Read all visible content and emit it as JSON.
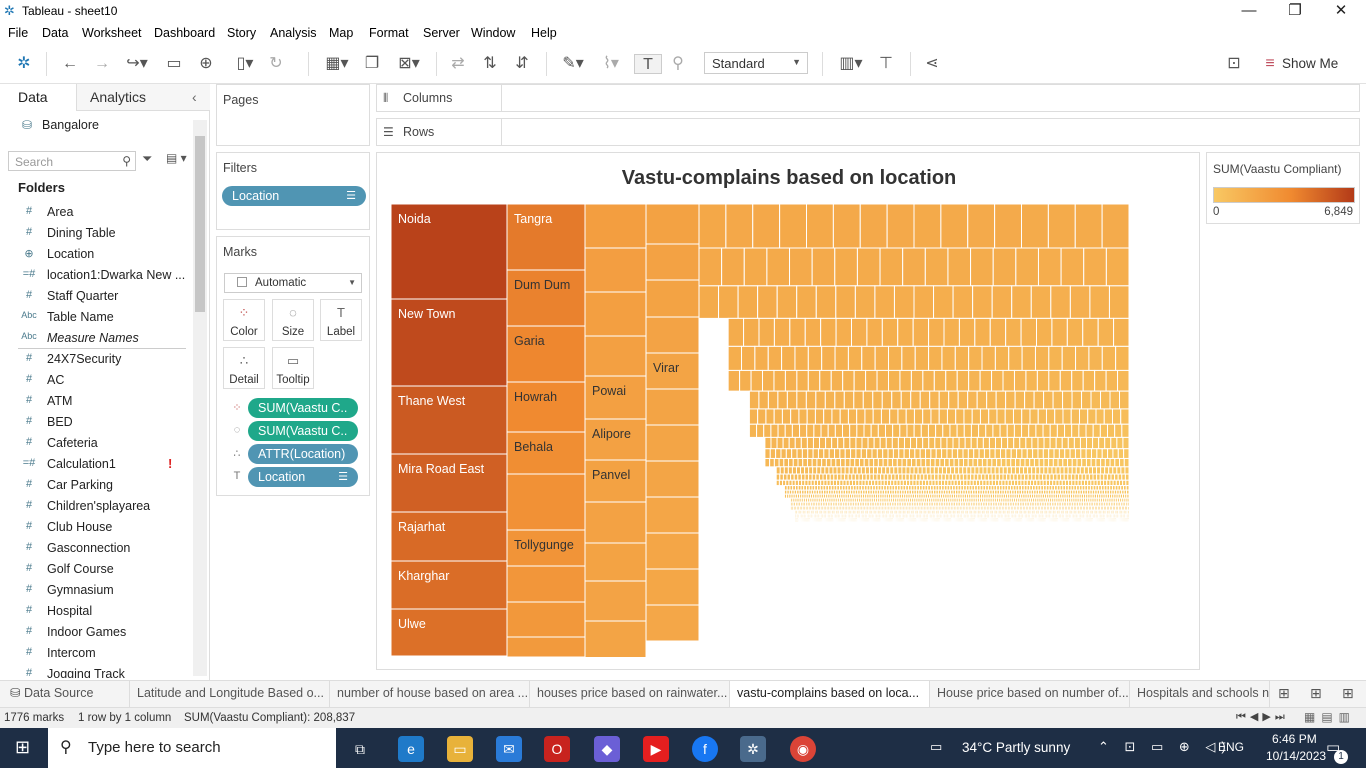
{
  "window": {
    "title": "Tableau - sheet10",
    "min": "—",
    "max": "❐",
    "close": "✕"
  },
  "menu": [
    "File",
    "Data",
    "Worksheet",
    "Dashboard",
    "Story",
    "Analysis",
    "Map",
    "Format",
    "Server",
    "Window",
    "Help"
  ],
  "toolbar": {
    "fit": "Standard",
    "show_me": "Show Me"
  },
  "pane": {
    "tab_data": "Data",
    "tab_analytics": "Analytics",
    "datasource": "Bangalore",
    "search_placeholder": "Search",
    "folders_label": "Folders",
    "fields": [
      {
        "icon": "#",
        "name": "Area",
        "italic": false
      },
      {
        "icon": "#",
        "name": "Dining Table",
        "italic": false
      },
      {
        "icon": "⊕",
        "name": "Location",
        "italic": false
      },
      {
        "icon": "=#",
        "name": "location1:Dwarka New ...",
        "italic": false
      },
      {
        "icon": "#",
        "name": "Staff Quarter",
        "italic": false
      },
      {
        "icon": "Abc",
        "name": "Table Name",
        "italic": false
      },
      {
        "icon": "Abc",
        "name": "Measure Names",
        "italic": true
      },
      {
        "icon": "#",
        "name": "24X7Security",
        "italic": false
      },
      {
        "icon": "#",
        "name": "AC",
        "italic": false
      },
      {
        "icon": "#",
        "name": "ATM",
        "italic": false
      },
      {
        "icon": "#",
        "name": "BED",
        "italic": false
      },
      {
        "icon": "#",
        "name": "Cafeteria",
        "italic": false
      },
      {
        "icon": "=#",
        "name": "Calculation1",
        "italic": false
      },
      {
        "icon": "#",
        "name": "Car Parking",
        "italic": false
      },
      {
        "icon": "#",
        "name": "Children'splayarea",
        "italic": false
      },
      {
        "icon": "#",
        "name": "Club House",
        "italic": false
      },
      {
        "icon": "#",
        "name": "Gasconnection",
        "italic": false
      },
      {
        "icon": "#",
        "name": "Golf Course",
        "italic": false
      },
      {
        "icon": "#",
        "name": "Gymnasium",
        "italic": false
      },
      {
        "icon": "#",
        "name": "Hospital",
        "italic": false
      },
      {
        "icon": "#",
        "name": "Indoor Games",
        "italic": false
      },
      {
        "icon": "#",
        "name": "Intercom",
        "italic": false
      },
      {
        "icon": "#",
        "name": "Jogging Track",
        "italic": false
      }
    ],
    "calc_warning": "!"
  },
  "shelves": {
    "pages": "Pages",
    "filters": "Filters",
    "filter_pill": "Location",
    "marks": "Marks",
    "mark_type": "Automatic",
    "mark_buttons": [
      "Color",
      "Size",
      "Label",
      "Detail",
      "Tooltip"
    ],
    "mark_pills": [
      "SUM(Vaastu C..",
      "SUM(Vaastu C..",
      "ATTR(Location)",
      "Location"
    ],
    "columns": "Columns",
    "rows": "Rows"
  },
  "chart_data": {
    "type": "treemap",
    "title": "Vastu-complains based on location",
    "labeled_tiles": [
      "Noida",
      "New Town",
      "Thane West",
      "Mira Road East",
      "Rajarhat",
      "Kharghar",
      "Ulwe",
      "Tangra",
      "Dum Dum",
      "Garia",
      "Howrah",
      "Behala",
      "Tollygunge",
      "Powai",
      "Alipore",
      "Panvel",
      "Virar"
    ],
    "color_scale": {
      "low": "#f8c863",
      "mid": "#f08a30",
      "high": "#b33a18"
    }
  },
  "legend": {
    "title": "SUM(Vaastu Compliant)",
    "min": "0",
    "max": "6,849"
  },
  "tabs": {
    "datasource": "Data Source",
    "sheets": [
      "Latitude and Longitude Based o...",
      "number of house based on area ...",
      "houses price based on rainwater...",
      "vastu-complains based on loca...",
      "House price based on number of...",
      "Hospitals and schools ne"
    ]
  },
  "status": {
    "marks": "1776 marks",
    "rowscols": "1 row by 1 column",
    "sum": "SUM(Vaastu Compliant): 208,837"
  },
  "taskbar": {
    "search": "Type here to search",
    "weather": "34°C  Partly sunny",
    "lang": "ENG",
    "time": "6:46 PM",
    "date": "10/14/2023",
    "notif": "1"
  }
}
